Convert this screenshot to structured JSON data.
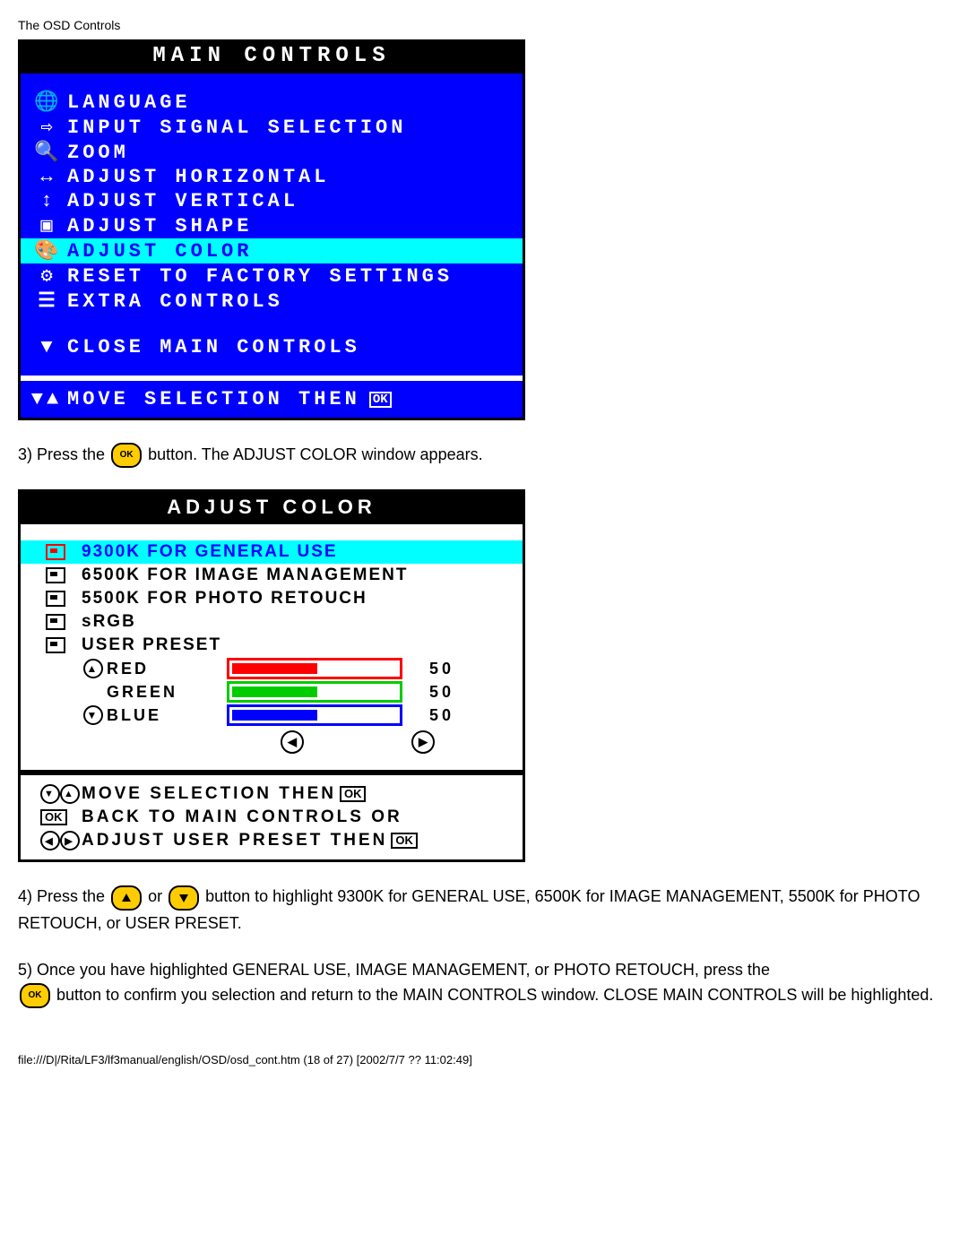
{
  "page_header": "The OSD Controls",
  "main_controls": {
    "title": "MAIN CONTROLS",
    "items": [
      {
        "icon": "🌐",
        "label": "LANGUAGE",
        "selected": false
      },
      {
        "icon": "⇨",
        "label": "INPUT SIGNAL SELECTION",
        "selected": false
      },
      {
        "icon": "🔍",
        "label": "ZOOM",
        "selected": false
      },
      {
        "icon": "↔",
        "label": "ADJUST HORIZONTAL",
        "selected": false
      },
      {
        "icon": "↕",
        "label": "ADJUST VERTICAL",
        "selected": false
      },
      {
        "icon": "▣",
        "label": "ADJUST SHAPE",
        "selected": false
      },
      {
        "icon": "🎨",
        "label": "ADJUST COLOR",
        "selected": true
      },
      {
        "icon": "⚙",
        "label": "RESET TO FACTORY SETTINGS",
        "selected": false
      },
      {
        "icon": "☰",
        "label": "EXTRA CONTROLS",
        "selected": false
      }
    ],
    "close_icon": "▼",
    "close_label": "CLOSE MAIN CONTROLS",
    "footer_icon": "▼▲",
    "footer_label": "MOVE SELECTION THEN",
    "ok": "OK"
  },
  "step3": {
    "prefix": "3) Press the",
    "btn": "OK",
    "suffix": "button. The ADJUST COLOR window appears."
  },
  "adjust_color": {
    "title": "ADJUST COLOR",
    "options": [
      {
        "label": "9300K FOR GENERAL USE",
        "selected": true
      },
      {
        "label": "6500K FOR IMAGE MANAGEMENT",
        "selected": false
      },
      {
        "label": "5500K FOR PHOTO RETOUCH",
        "selected": false
      },
      {
        "label": "sRGB",
        "selected": false
      },
      {
        "label": "USER PRESET",
        "selected": false
      }
    ],
    "presets": [
      {
        "name": "RED",
        "icon": "▲",
        "value": "50",
        "cls": "bar-red"
      },
      {
        "name": "GREEN",
        "icon": "",
        "value": "50",
        "cls": "bar-green"
      },
      {
        "name": "BLUE",
        "icon": "▼",
        "value": "50",
        "cls": "bar-blue"
      }
    ],
    "left": "◀",
    "right": "▶",
    "footer": [
      {
        "icons": [
          "▼",
          "▲"
        ],
        "text": "MOVE SELECTION THEN",
        "trail": "OK"
      },
      {
        "icons": [
          "OK"
        ],
        "text": "BACK TO MAIN CONTROLS OR",
        "trail": ""
      },
      {
        "icons": [
          "◀",
          "▶"
        ],
        "text": "ADJUST USER PRESET THEN",
        "trail": "OK"
      }
    ]
  },
  "step4": {
    "prefix": "4) Press the",
    "or": "or",
    "suffix": "button to highlight 9300K for GENERAL USE, 6500K for IMAGE MANAGEMENT, 5500K for PHOTO RETOUCH, or USER PRESET."
  },
  "step5": {
    "line1_prefix": "5) Once you have highlighted GENERAL USE, IMAGE MANAGEMENT, or PHOTO RETOUCH, press the",
    "line2": "button to confirm you selection and return to the MAIN CONTROLS window. CLOSE MAIN CONTROLS will be highlighted."
  },
  "page_footer": "file:///D|/Rita/LF3/lf3manual/english/OSD/osd_cont.htm (18 of 27) [2002/7/7 ?? 11:02:49]"
}
